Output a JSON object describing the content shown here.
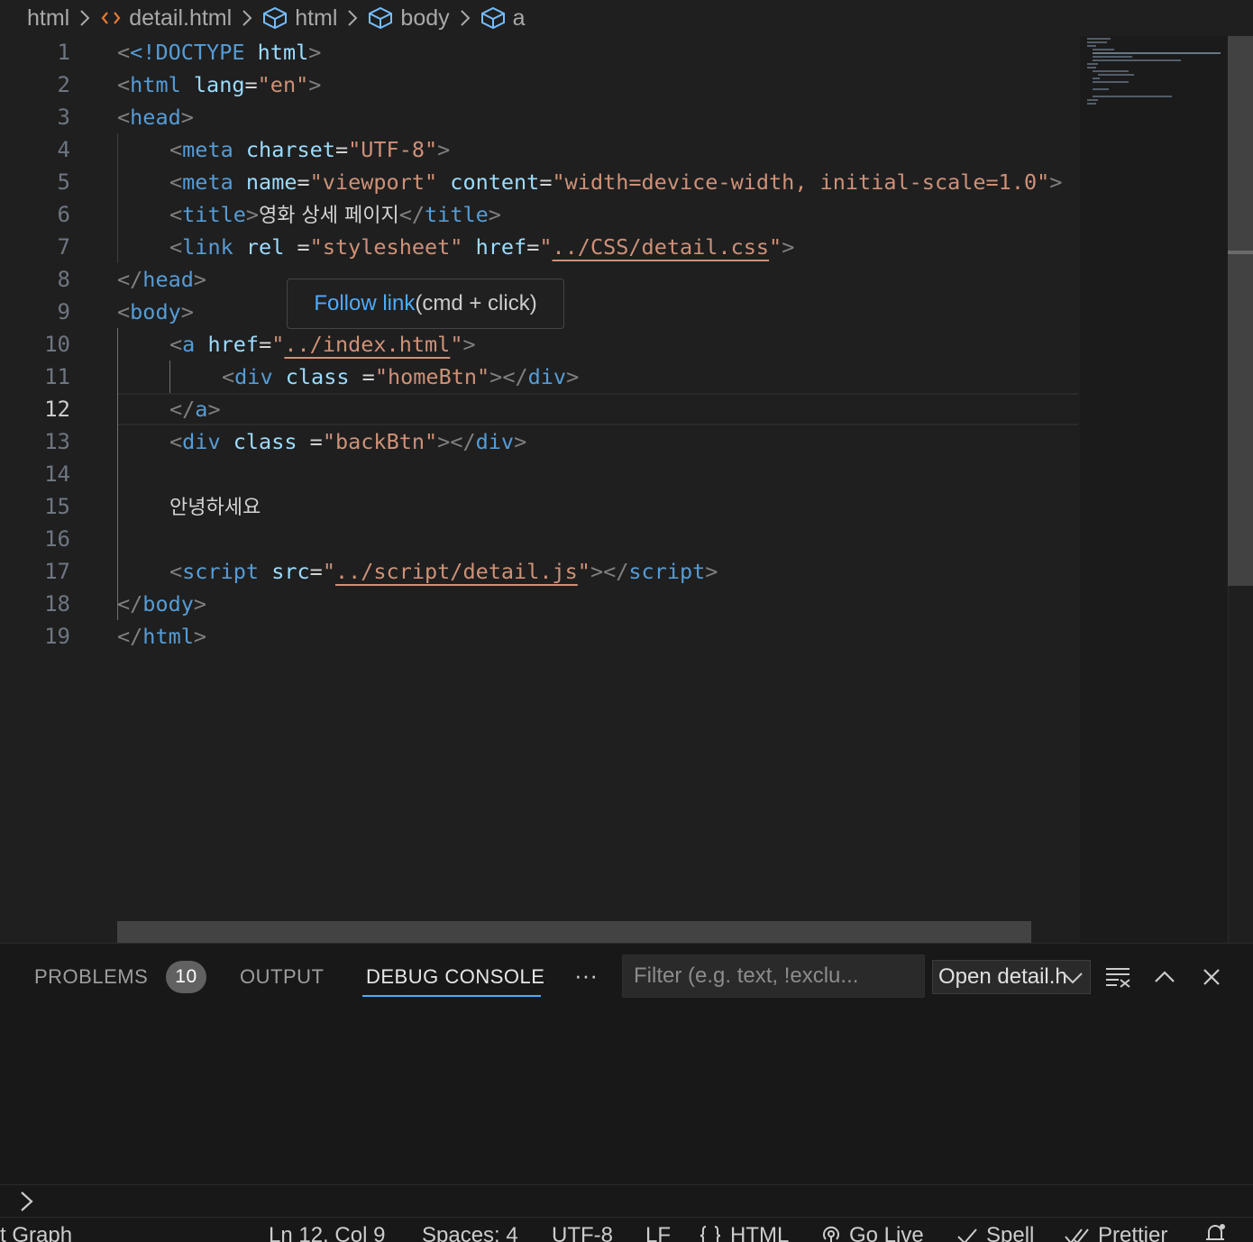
{
  "breadcrumb": {
    "items": [
      {
        "label": "html",
        "icon": "folder"
      },
      {
        "label": "detail.html",
        "icon": "html-file-icon"
      },
      {
        "label": "html",
        "icon": "symbol-element-icon"
      },
      {
        "label": "body",
        "icon": "symbol-element-icon"
      },
      {
        "label": "a",
        "icon": "symbol-element-icon"
      }
    ]
  },
  "editor": {
    "line_numbers": [
      "1",
      "2",
      "3",
      "4",
      "5",
      "6",
      "7",
      "8",
      "9",
      "10",
      "11",
      "12",
      "13",
      "14",
      "15",
      "16",
      "17",
      "18",
      "19"
    ],
    "active_line": "12",
    "code": {
      "l1_doctype": "<!DOCTYPE",
      "l1_html": "html",
      "l2_tag": "html",
      "l2_attr": "lang",
      "l2_val": "\"en\"",
      "l3_tag": "head",
      "l4_tag": "meta",
      "l4_attr": "charset",
      "l4_val": "\"UTF-8\"",
      "l5_tag": "meta",
      "l5_attr1": "name",
      "l5_val1": "\"viewport\"",
      "l5_attr2": "content",
      "l5_val2": "\"width=device-width, initial-scale=1.0\"",
      "l6_tag": "title",
      "l6_text": "영화 상세 페이지",
      "l6_close": "title",
      "l7_tag": "link",
      "l7_attr1": "rel",
      "l7_val1": "\"stylesheet\"",
      "l7_attr2": "href",
      "l7_link": "../CSS/detail.css",
      "l8_tag": "head",
      "l9_tag": "body",
      "l10_tag": "a",
      "l10_attr": "href",
      "l10_link": "../index.html",
      "l11_tag": "div",
      "l11_attr": "class",
      "l11_val": "\"homeBtn\"",
      "l11_close": "div",
      "l12_tag": "a",
      "l13_tag": "div",
      "l13_attr": "class",
      "l13_val": "\"backBtn\"",
      "l13_close": "div",
      "l15_text": "안녕하세요",
      "l17_tag": "script",
      "l17_attr": "src",
      "l17_link": "../script/detail.js",
      "l17_close": "script",
      "l18_tag": "body",
      "l19_tag": "html"
    },
    "tooltip": {
      "link_text": "Follow link",
      "hint": " (cmd + click)"
    }
  },
  "panel": {
    "tabs": [
      {
        "label": "PROBLEMS",
        "badge": "10"
      },
      {
        "label": "OUTPUT"
      },
      {
        "label": "DEBUG CONSOLE",
        "active": true
      }
    ],
    "more_label": "···",
    "filter_placeholder": "Filter (e.g. text, !exclu...",
    "select_value": "Open detail.h",
    "icons": [
      "clear-console-icon",
      "chevron-up-icon",
      "close-icon"
    ]
  },
  "statusbar": {
    "left": "t Graph",
    "position": "Ln 12, Col 9",
    "spaces": "Spaces: 4",
    "encoding": "UTF-8",
    "eol": "LF",
    "language": "HTML",
    "go_live": "Go Live",
    "spell": "Spell",
    "prettier": "Prettier"
  },
  "colors": {
    "tag": "#569cd6",
    "attribute": "#9cdcfe",
    "string": "#ce9178",
    "accent": "#4daafc"
  }
}
